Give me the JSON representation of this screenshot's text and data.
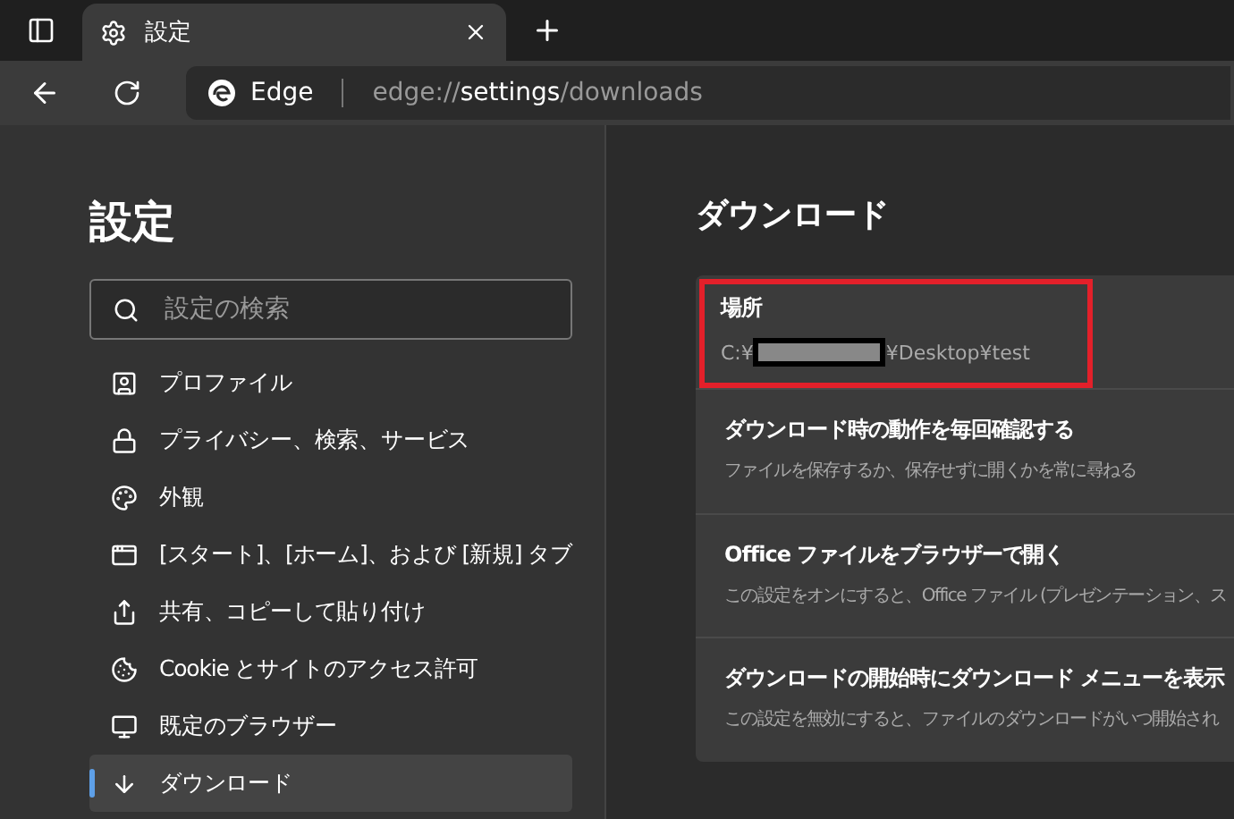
{
  "tabs": [
    {
      "title": "設定",
      "selected": true
    }
  ],
  "address_bar": {
    "site_label": "Edge",
    "url_prefix": "edge://",
    "url_host": "settings",
    "url_path": "/downloads"
  },
  "sidebar": {
    "title": "設定",
    "search": {
      "placeholder": "設定の検索"
    },
    "items": [
      {
        "label": "プロファイル",
        "selected": false
      },
      {
        "label": "プライバシー、検索、サービス",
        "selected": false
      },
      {
        "label": "外観",
        "selected": false
      },
      {
        "label": "[スタート]、[ホーム]、および [新規] タブ",
        "selected": false
      },
      {
        "label": "共有、コピーして貼り付け",
        "selected": false
      },
      {
        "label": "Cookie とサイトのアクセス許可",
        "selected": false
      },
      {
        "label": "既定のブラウザー",
        "selected": false
      },
      {
        "label": "ダウンロード",
        "selected": true
      }
    ]
  },
  "content": {
    "title": "ダウンロード",
    "settings": [
      {
        "kind": "path",
        "title": "場所",
        "path_prefix": "C:¥",
        "path_suffix": "¥Desktop¥test",
        "highlighted": true
      },
      {
        "kind": "option",
        "title": "ダウンロード時の動作を毎回確認する",
        "description": "ファイルを保存するか、保存せずに開くかを常に尋ねる",
        "highlighted": false
      },
      {
        "kind": "option",
        "title": "Office ファイルをブラウザーで開く",
        "description": "この設定をオンにすると、Office ファイル (プレゼンテーション、ス",
        "highlighted": false
      },
      {
        "kind": "option",
        "title": "ダウンロードの開始時にダウンロード メニューを表示",
        "description": "この設定を無効にすると、ファイルのダウンロードがいつ開始され",
        "highlighted": false
      }
    ]
  }
}
